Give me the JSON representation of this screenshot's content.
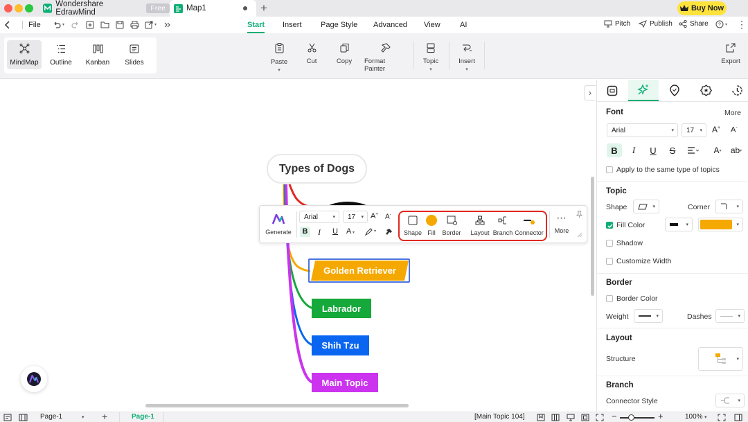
{
  "titlebar": {
    "app_tab": "Wondershare EdrawMind",
    "app_badge": "Free",
    "doc_tab": "Map1",
    "buy_now": "Buy Now"
  },
  "menubar": {
    "file": "File",
    "tabs": [
      "Start",
      "Insert",
      "Page Style",
      "Advanced",
      "View",
      "AI"
    ],
    "active_tab": "Start",
    "right": {
      "pitch": "Pitch",
      "publish": "Publish",
      "share": "Share"
    }
  },
  "ribbon": {
    "views": [
      "MindMap",
      "Outline",
      "Kanban",
      "Slides"
    ],
    "active_view": "MindMap",
    "tools": {
      "paste": "Paste",
      "cut": "Cut",
      "copy": "Copy",
      "format_painter": "Format Painter",
      "topic": "Topic",
      "insert": "Insert"
    },
    "export": "Export"
  },
  "mindmap": {
    "root": "Types of Dogs",
    "topics": [
      {
        "label": "Golden Retriever",
        "color": "#f5a800"
      },
      {
        "label": "Labrador",
        "color": "#15a83a"
      },
      {
        "label": "Shih Tzu",
        "color": "#0a66f0"
      },
      {
        "label": "Main Topic",
        "color": "#cc33ee"
      }
    ]
  },
  "floating_toolbar": {
    "generate": "Generate",
    "font": "Arial",
    "size": "17",
    "shape": "Shape",
    "fill": "Fill",
    "border": "Border",
    "layout": "Layout",
    "branch": "Branch",
    "connector": "Connector",
    "more": "More",
    "fill_color": "#f5a800"
  },
  "sidebar": {
    "font_section": "Font",
    "more": "More",
    "font_name": "Arial",
    "font_size": "17",
    "apply_same": "Apply to the same type of topics",
    "topic_section": "Topic",
    "shape_label": "Shape",
    "corner_label": "Corner",
    "fill_color_label": "Fill Color",
    "fill_color_checked": true,
    "fill_color": "#f5a800",
    "shadow_label": "Shadow",
    "customize_width": "Customize Width",
    "border_section": "Border",
    "border_color": "Border Color",
    "weight_label": "Weight",
    "dashes_label": "Dashes",
    "layout_section": "Layout",
    "structure_label": "Structure",
    "branch_section": "Branch",
    "connector_style": "Connector Style"
  },
  "statusbar": {
    "page_select": "Page-1",
    "page_tab": "Page-1",
    "selection": "[Main Topic 104]",
    "zoom": "100%"
  },
  "accent_color": "#0fae75",
  "highlight_color": "#e0281f"
}
